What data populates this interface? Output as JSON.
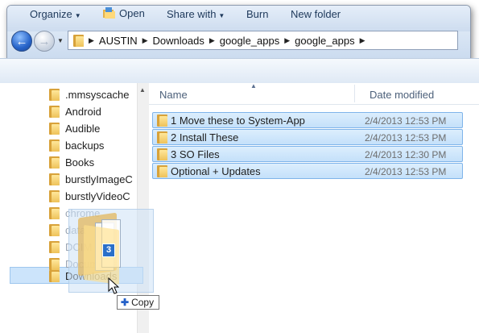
{
  "address": {
    "breadcrumbs": [
      "AUSTIN",
      "Downloads",
      "google_apps",
      "google_apps"
    ]
  },
  "toolbar": {
    "organize": "Organize",
    "open": "Open",
    "share_with": "Share with",
    "burn": "Burn",
    "new_folder": "New folder"
  },
  "nav_tree": [
    {
      "label": ".mmsyscache",
      "state": "normal"
    },
    {
      "label": "Android",
      "state": "normal"
    },
    {
      "label": "Audible",
      "state": "normal"
    },
    {
      "label": "backups",
      "state": "normal"
    },
    {
      "label": "Books",
      "state": "normal"
    },
    {
      "label": "burstlyImageC",
      "state": "normal"
    },
    {
      "label": "burstlyVideoC",
      "state": "normal"
    },
    {
      "label": "chrome",
      "state": "faded"
    },
    {
      "label": "data",
      "state": "faded"
    },
    {
      "label": "DCIM",
      "state": "faded"
    },
    {
      "label": "Documents",
      "state": "faded"
    },
    {
      "label": "Downloads",
      "state": "selected"
    }
  ],
  "columns": {
    "name": "Name",
    "date_modified": "Date modified"
  },
  "files": [
    {
      "name": "1 Move these to System-App",
      "date": "2/4/2013 12:53 PM"
    },
    {
      "name": "2 Install These",
      "date": "2/4/2013 12:53 PM"
    },
    {
      "name": "3 SO Files",
      "date": "2/4/2013 12:30 PM"
    },
    {
      "name": "Optional + Updates",
      "date": "2/4/2013 12:53 PM"
    }
  ],
  "drag": {
    "item_count": "3",
    "tooltip": "Copy"
  },
  "colors": {
    "selection_fill": "#c4e0fa",
    "selection_border": "#7fb4ea",
    "badge": "#2a6fc9",
    "toolbar_text": "#1e395b"
  }
}
